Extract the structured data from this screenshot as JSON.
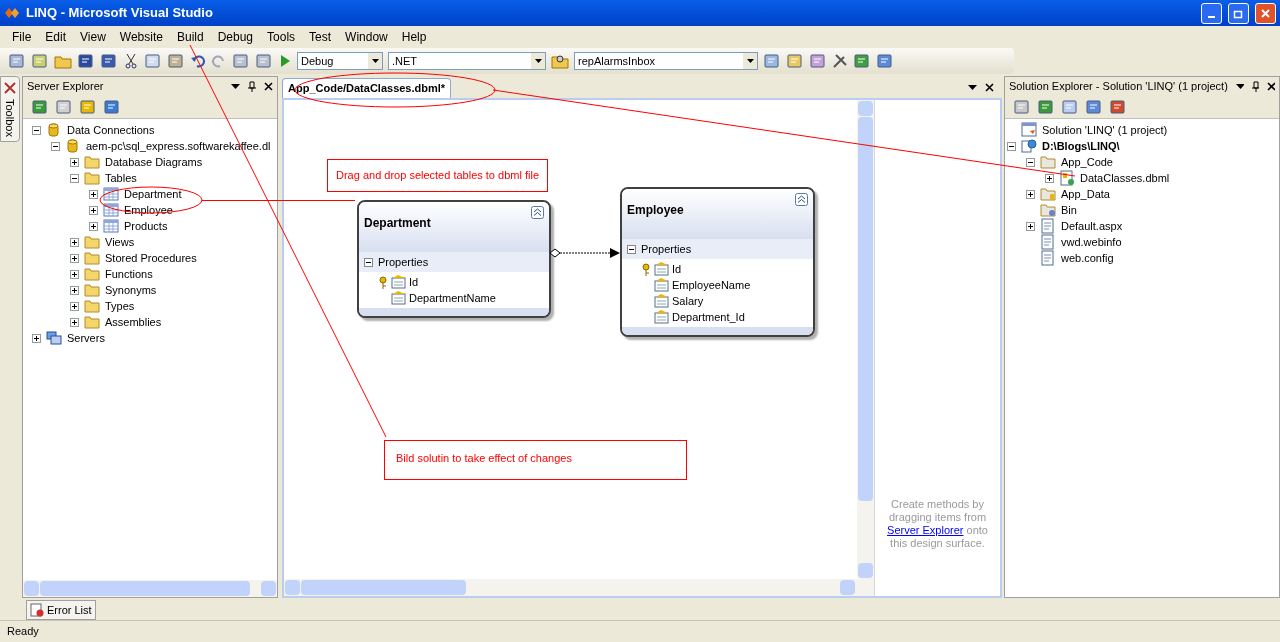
{
  "window": {
    "title": "LINQ - Microsoft Visual Studio"
  },
  "menu": [
    "File",
    "Edit",
    "View",
    "Website",
    "Build",
    "Debug",
    "Tools",
    "Test",
    "Window",
    "Help"
  ],
  "toolbar": {
    "configuration": "Debug",
    "platform": ".NET",
    "find": "repAlarmsInbox"
  },
  "toolbox_tab": "Toolbox",
  "server_explorer": {
    "title": "Server Explorer",
    "tree": [
      {
        "label": "Data Connections",
        "kind": "connections",
        "expanded": true,
        "children": [
          {
            "label": "aem-pc\\sql_express.softwarekaffee.dl",
            "kind": "database",
            "expanded": true,
            "children": [
              {
                "label": "Database Diagrams",
                "kind": "folder",
                "expanded": false
              },
              {
                "label": "Tables",
                "kind": "folder",
                "expanded": true,
                "children": [
                  {
                    "label": "Department",
                    "kind": "table",
                    "expanded": false
                  },
                  {
                    "label": "Employee",
                    "kind": "table",
                    "expanded": false
                  },
                  {
                    "label": "Products",
                    "kind": "table",
                    "expanded": false
                  }
                ]
              },
              {
                "label": "Views",
                "kind": "folder",
                "expanded": false
              },
              {
                "label": "Stored Procedures",
                "kind": "folder",
                "expanded": false
              },
              {
                "label": "Functions",
                "kind": "folder",
                "expanded": false
              },
              {
                "label": "Synonyms",
                "kind": "folder",
                "expanded": false
              },
              {
                "label": "Types",
                "kind": "folder",
                "expanded": false
              },
              {
                "label": "Assemblies",
                "kind": "folder",
                "expanded": false
              }
            ]
          }
        ]
      },
      {
        "label": "Servers",
        "kind": "servers",
        "expanded": false
      }
    ]
  },
  "document": {
    "tabs": [
      {
        "label": "App_Code/DataClasses.dbml*",
        "selected": true
      }
    ],
    "entities": [
      {
        "name": "Department",
        "section": "Properties",
        "properties": [
          {
            "name": "Id",
            "key": true
          },
          {
            "name": "DepartmentName",
            "key": false
          }
        ]
      },
      {
        "name": "Employee",
        "section": "Properties",
        "properties": [
          {
            "name": "Id",
            "key": true
          },
          {
            "name": "EmployeeName",
            "key": false
          },
          {
            "name": "Salary",
            "key": false
          },
          {
            "name": "Department_Id",
            "key": false
          }
        ]
      }
    ],
    "callouts": [
      "Drag and drop selected tables to dbml file",
      "Bild solutin to take effect of changes"
    ],
    "methods_hint": {
      "before": "Create methods by dragging items from",
      "link": "Server Explorer",
      "after": "onto this design surface."
    }
  },
  "solution_explorer": {
    "title": "Solution Explorer - Solution 'LINQ' (1 project)",
    "tree": [
      {
        "label": "Solution 'LINQ' (1 project)",
        "kind": "solution"
      },
      {
        "label": "D:\\Blogs\\LINQ\\",
        "kind": "project",
        "expanded": true,
        "children": [
          {
            "label": "App_Code",
            "kind": "folder-open",
            "expanded": true,
            "children": [
              {
                "label": "DataClasses.dbml",
                "kind": "dbml",
                "expanded": false
              }
            ]
          },
          {
            "label": "App_Data",
            "kind": "folder-data",
            "expanded": false
          },
          {
            "label": "Bin",
            "kind": "folder-bin"
          },
          {
            "label": "Default.aspx",
            "kind": "aspx",
            "expanded": false
          },
          {
            "label": "vwd.webinfo",
            "kind": "webinfo"
          },
          {
            "label": "web.config",
            "kind": "config"
          }
        ]
      }
    ]
  },
  "bottom_tabs": [
    "Error List"
  ],
  "status_bar": "Ready"
}
